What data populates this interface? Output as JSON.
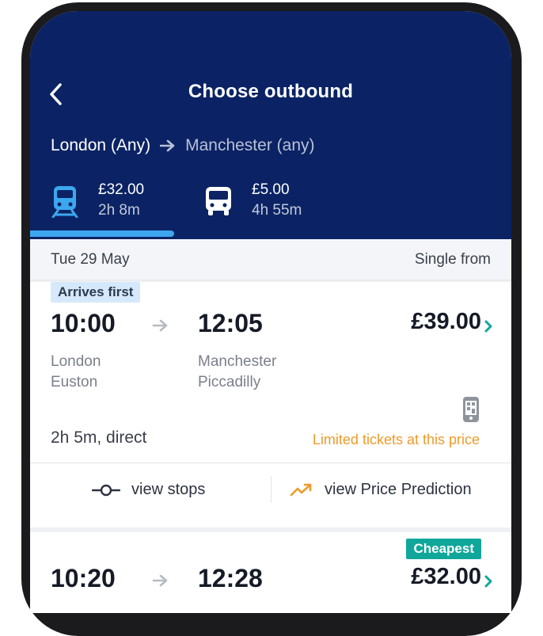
{
  "header": {
    "title": "Choose outbound",
    "route_from": "London (Any)",
    "route_to": "Manchester (any)"
  },
  "modes": [
    {
      "name": "train",
      "icon": "train-icon",
      "price": "£32.00",
      "duration": "2h 8m",
      "selected": true
    },
    {
      "name": "bus",
      "icon": "bus-icon",
      "price": "£5.00",
      "duration": "4h 55m",
      "selected": false
    }
  ],
  "datebar": {
    "date": "Tue 29 May",
    "label": "Single from"
  },
  "journeys": [
    {
      "badge": "Arrives first",
      "depart_time": "10:00",
      "arrive_time": "12:05",
      "origin_line1": "London",
      "origin_line2": "Euston",
      "dest_line1": "Manchester",
      "dest_line2": "Piccadilly",
      "price": "£39.00",
      "summary": "2h 5m, direct",
      "warning": "Limited tickets at this price",
      "actions": {
        "stops": "view stops",
        "prediction": "view Price Prediction"
      }
    },
    {
      "badge": "Cheapest",
      "depart_time": "10:20",
      "arrive_time": "12:28",
      "price": "£32.00"
    }
  ],
  "colors": {
    "header_bg": "#0b2364",
    "tab_indicator": "#3ca7ee",
    "warning": "#ef9a2b",
    "cheapest_badge": "#10a79a",
    "chevron": "#10a79a"
  }
}
